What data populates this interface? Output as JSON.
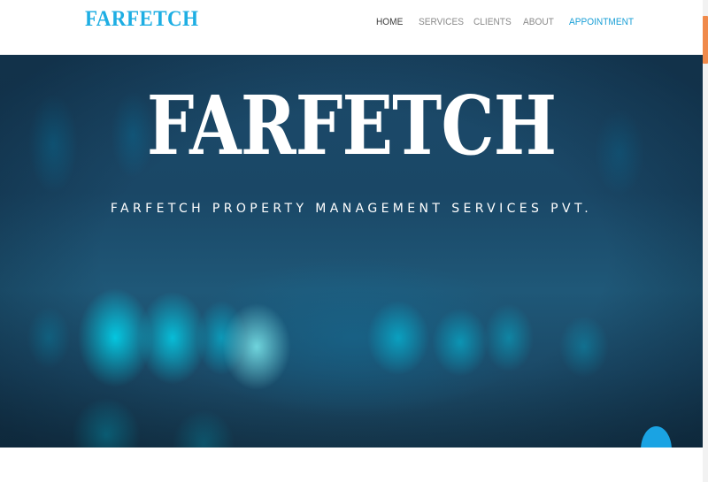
{
  "header": {
    "logo": "FARFETCH",
    "nav": [
      {
        "label": "HOME",
        "state": "active"
      },
      {
        "label": "SERVICES",
        "state": "default"
      },
      {
        "label": "CLIENTS",
        "state": "default"
      },
      {
        "label": "ABOUT",
        "state": "default"
      },
      {
        "label": "APPOINTMENT",
        "state": "highlight"
      }
    ]
  },
  "hero": {
    "title": "FARFETCH",
    "subtitle": "FARFETCH PROPERTY MANAGEMENT SERVICES PVT."
  },
  "scroll_top_button": {
    "icon": "chevron-up-icon"
  },
  "colors": {
    "brand": "#1eaee3",
    "nav_highlight": "#1a9fd6",
    "button": "#1aa3e3",
    "scroll_thumb": "#f08a4b"
  }
}
